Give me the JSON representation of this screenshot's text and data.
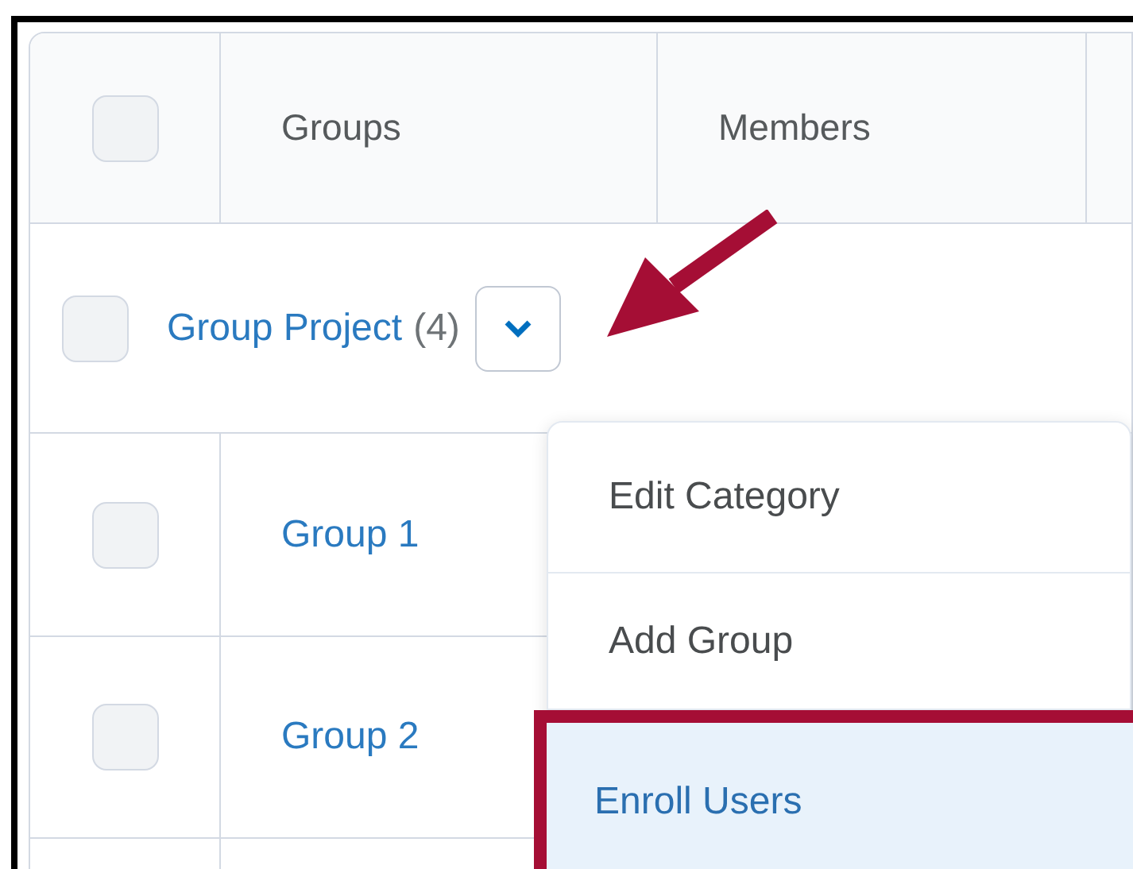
{
  "table": {
    "header": {
      "checked": false,
      "columns": [
        "Groups",
        "Members"
      ]
    },
    "category": {
      "name": "Group Project",
      "count": "(4)",
      "checked": false,
      "expanded": true
    },
    "rows": [
      {
        "name": "Group 1",
        "checked": false
      },
      {
        "name": "Group 2",
        "checked": false
      }
    ]
  },
  "menu": {
    "items": [
      {
        "label": "Edit Category",
        "selected": false,
        "highlighted": false
      },
      {
        "label": "Add Group",
        "selected": false,
        "highlighted": false
      },
      {
        "label": "Enroll Users",
        "selected": true,
        "highlighted": true
      }
    ]
  },
  "annotation": {
    "kind": "arrow"
  }
}
